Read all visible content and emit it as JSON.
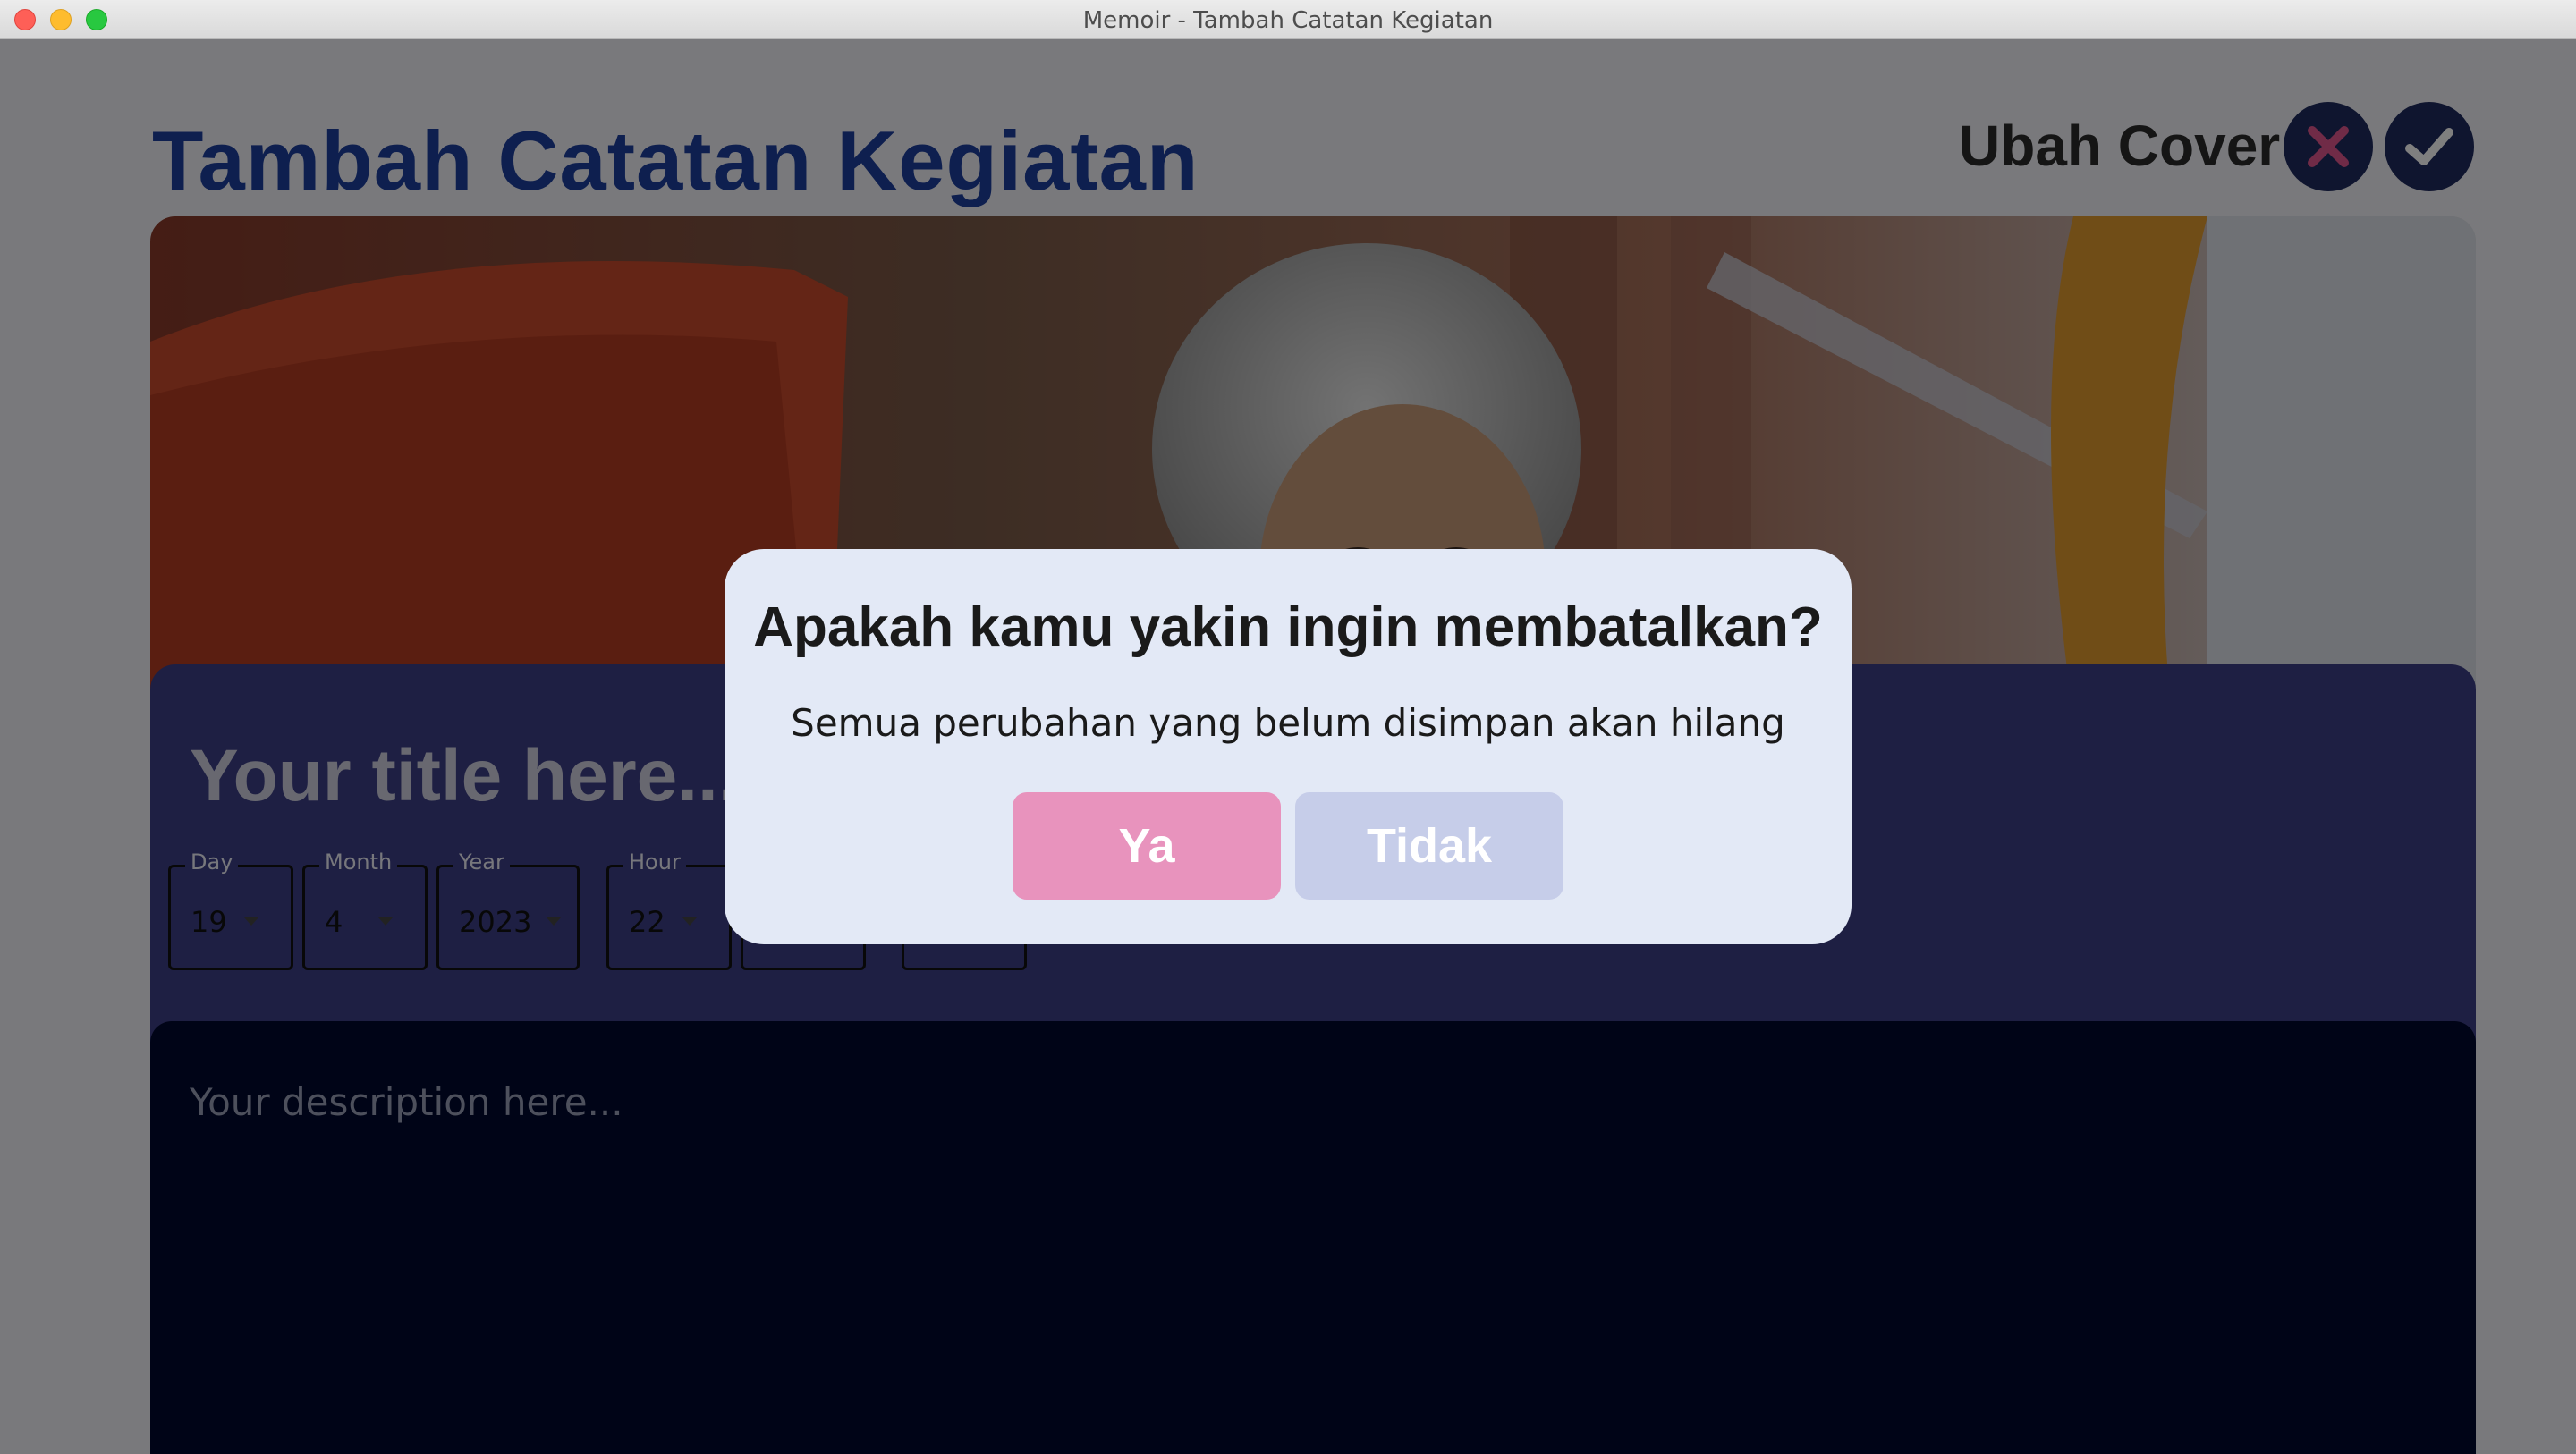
{
  "window": {
    "title": "Memoir - Tambah Catatan Kegiatan"
  },
  "header": {
    "title": "Tambah Catatan Kegiatan",
    "cover_label": "Ubah Cover"
  },
  "form": {
    "title_placeholder": "Your title here...",
    "dropdowns": [
      {
        "label": "Day",
        "value": "19"
      },
      {
        "label": "Month",
        "value": "4"
      },
      {
        "label": "Year",
        "value": "2023"
      },
      {
        "label": "Hour",
        "value": "22"
      },
      {
        "label": "",
        "value": ""
      },
      {
        "label": "",
        "value": ""
      }
    ],
    "description_placeholder": "Your description here..."
  },
  "dialog": {
    "title": "Apakah kamu yakin ingin membatalkan?",
    "message": "Semua perubahan yang belum disimpan akan hilang",
    "yes_label": "Ya",
    "no_label": "Tidak"
  },
  "colors": {
    "accent": "#1d3e9e",
    "card": "#3d3f86",
    "description_bg": "#00082e",
    "yes_button": "#e893bd",
    "no_button": "#c6cde9",
    "dialog_bg": "#e3e9f6"
  },
  "icons": {
    "cancel": "close-x-icon",
    "save": "checkmark-icon"
  }
}
